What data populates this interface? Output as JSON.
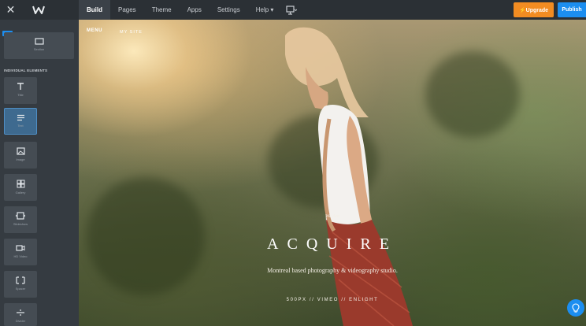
{
  "app": {
    "close_icon": "close-icon",
    "logo_icon": "weebly-logo-icon"
  },
  "nav": {
    "tabs": [
      {
        "label": "Build"
      },
      {
        "label": "Pages"
      },
      {
        "label": "Theme"
      },
      {
        "label": "Apps"
      },
      {
        "label": "Settings"
      },
      {
        "label": "Help ▾"
      }
    ],
    "active_tab": "Build",
    "device_icon": "monitor-dropdown-icon",
    "upgrade_label": "⚡Upgrade",
    "publish_label": "Publish"
  },
  "sidebar": {
    "new_badge": "NEW",
    "section_tile_label": "Section",
    "individual_heading": "INDIVIDUAL ELEMENTS",
    "elements": [
      {
        "label": "Title",
        "icon": "title-T-icon"
      },
      {
        "label": "Text",
        "icon": "text-lines-icon",
        "selected": true
      },
      {
        "label": "Image",
        "icon": "image-icon"
      },
      {
        "label": "Gallery",
        "icon": "gallery-grid-icon"
      },
      {
        "label": "Slideshow",
        "icon": "slideshow-icon"
      },
      {
        "label": "HD Video",
        "icon": "video-camera-icon",
        "pro": true
      },
      {
        "label": "Spacer",
        "icon": "spacer-icon"
      },
      {
        "label": "Divider",
        "icon": "divider-icon"
      }
    ]
  },
  "canvas": {
    "menu_label": "MENU",
    "site_label": "MY SITE",
    "we_are": "We Are",
    "title": "ACQUIRE",
    "subtitle": "Montreal based photography & videography studio.",
    "links": "500PX  //  VIMEO  //  ENLIGHT"
  },
  "colors": {
    "upgrade": "#f28c22",
    "publish": "#1c8ef0",
    "sidebar": "#353b41",
    "topbar": "#2b3035"
  },
  "help_icon": "lightbulb-help-icon"
}
